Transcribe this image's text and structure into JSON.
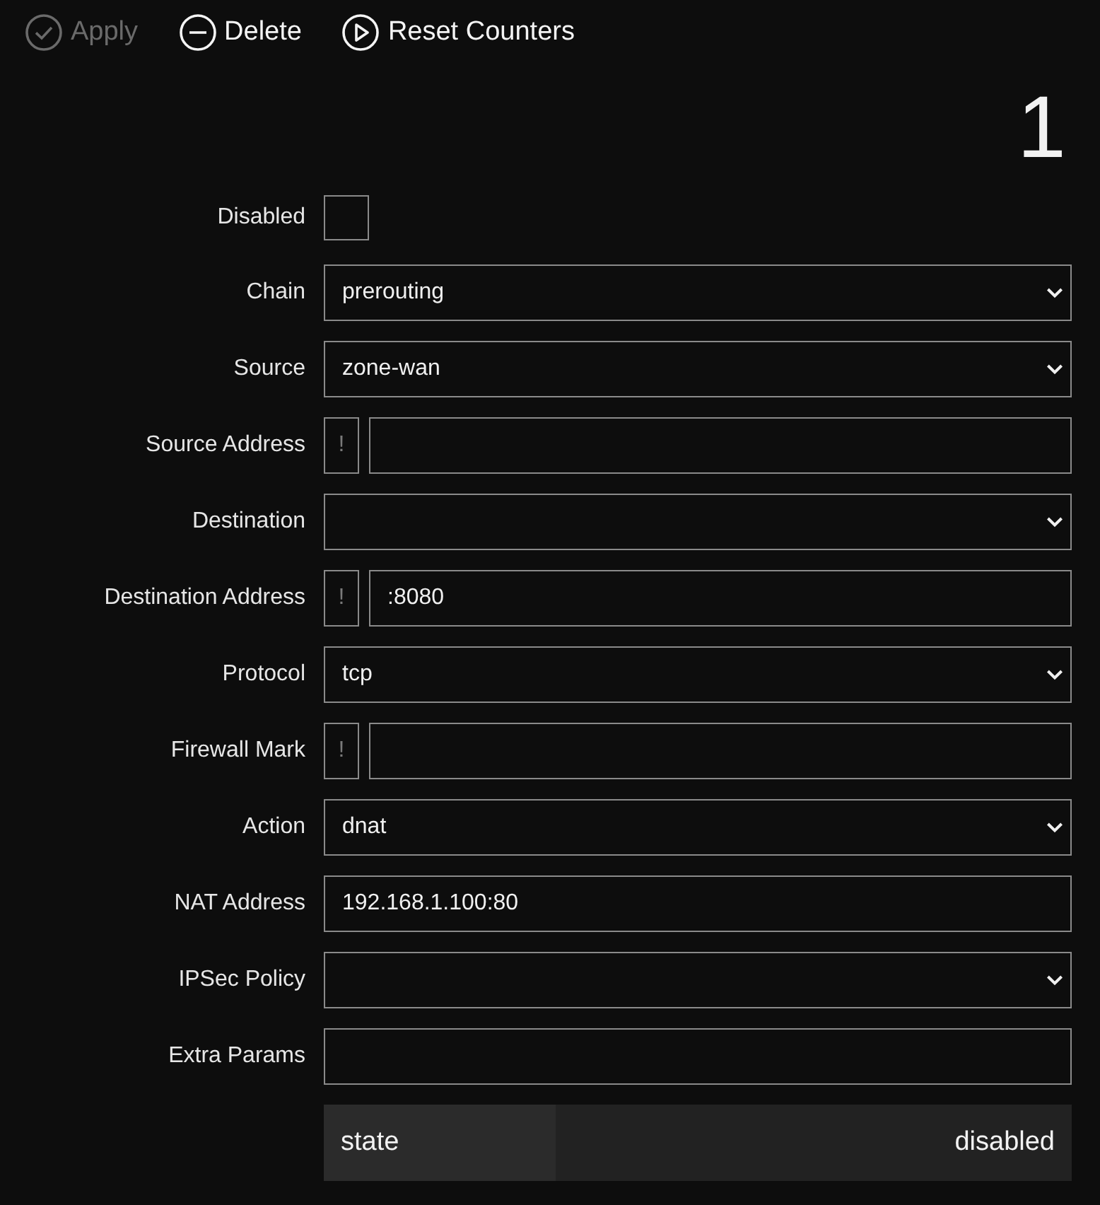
{
  "toolbar": [
    {
      "label": "Apply",
      "kind": "check",
      "disabled": true
    },
    {
      "label": "Delete",
      "kind": "minus",
      "disabled": false
    },
    {
      "label": "Reset Counters",
      "kind": "play",
      "disabled": false
    }
  ],
  "item_number": "1",
  "fields": [
    {
      "label": "Disabled",
      "kind": "checkbox",
      "checked": false
    },
    {
      "label": "Chain",
      "kind": "select",
      "value": "prerouting"
    },
    {
      "label": "Source",
      "kind": "select",
      "value": "zone-wan"
    },
    {
      "label": "Source Address",
      "kind": "negatable",
      "negate": {
        "label": "!",
        "on": false
      }
    },
    {
      "label": "Destination",
      "kind": "select"
    },
    {
      "label": "Destination Address",
      "kind": "negatable",
      "negate": {
        "label": "!",
        "on": false
      },
      "value": ":8080"
    },
    {
      "label": "Protocol",
      "kind": "select",
      "value": "tcp"
    },
    {
      "label": "Firewall Mark",
      "kind": "negatable",
      "negate": {
        "label": "!",
        "on": false
      }
    },
    {
      "label": "Action",
      "kind": "select",
      "value": "dnat"
    },
    {
      "label": "NAT Address",
      "kind": "input",
      "value": "192.168.1.100:80"
    },
    {
      "label": "IPSec Policy",
      "kind": "select"
    },
    {
      "label": "Extra Params",
      "kind": "input"
    }
  ],
  "status": {
    "label": "state",
    "value": "disabled"
  }
}
